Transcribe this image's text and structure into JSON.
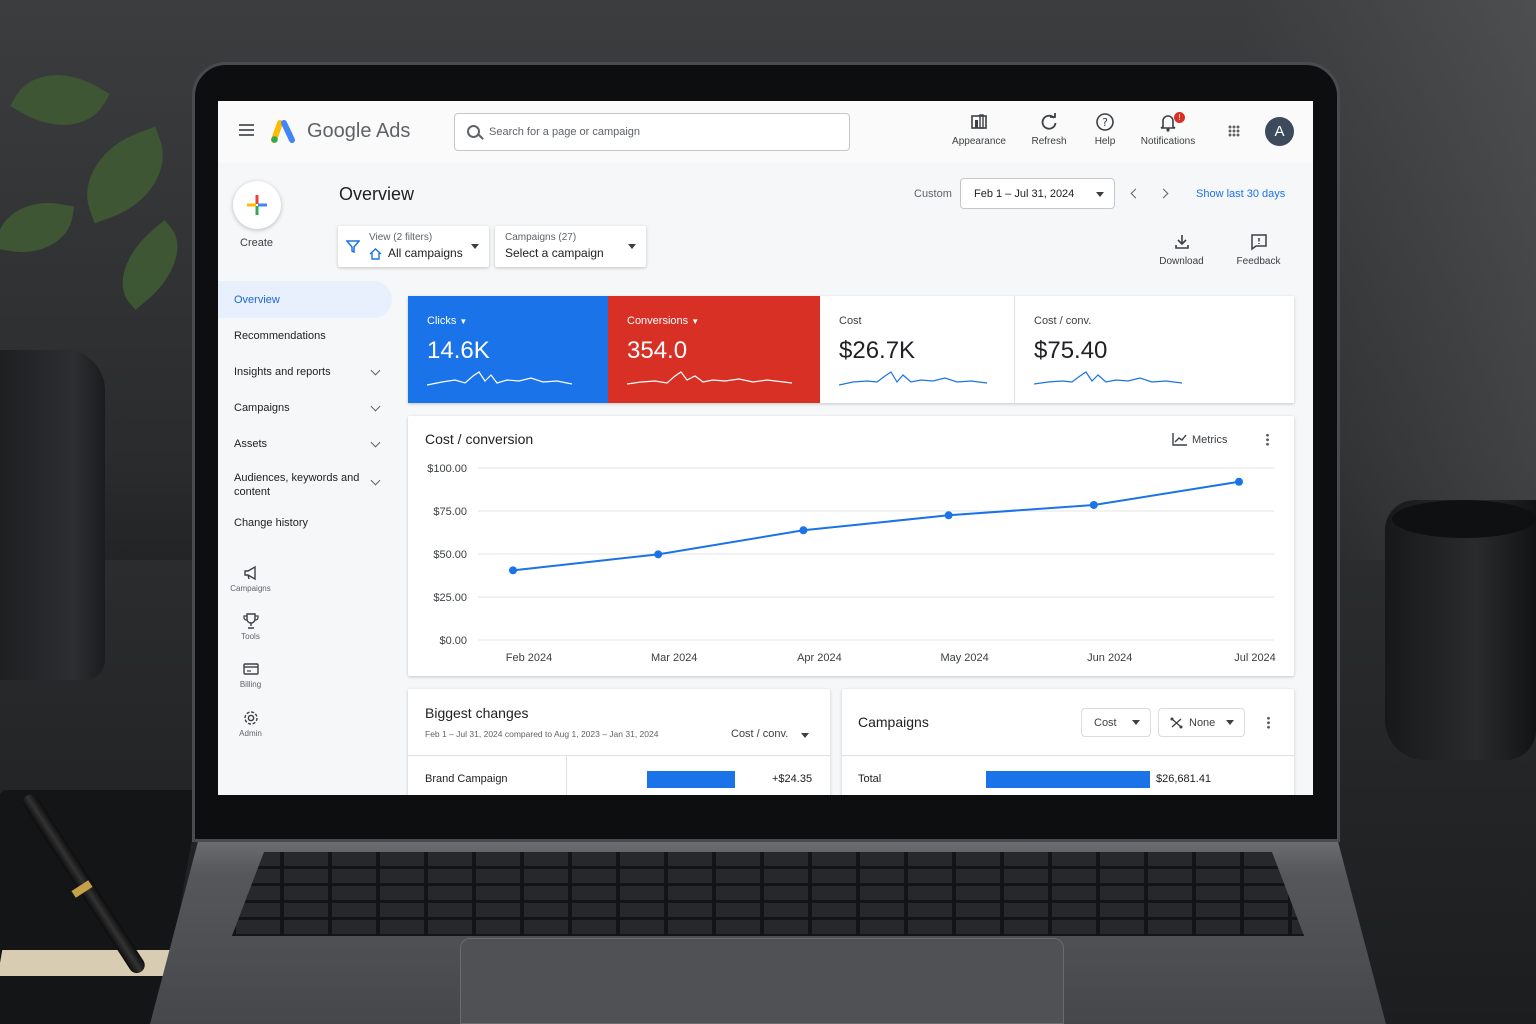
{
  "app": {
    "product_name": "Google Ads",
    "search_placeholder": "Search for a page or campaign",
    "avatar_letter": "A",
    "notification_count": "!",
    "toolbar": [
      {
        "label": "Appearance",
        "icon": "appearance-icon"
      },
      {
        "label": "Refresh",
        "icon": "refresh-icon"
      },
      {
        "label": "Help",
        "icon": "help-icon"
      },
      {
        "label": "Notifications",
        "icon": "bell-icon"
      }
    ]
  },
  "sidebar": {
    "create_label": "Create",
    "items": [
      {
        "label": "Overview",
        "active": true
      },
      {
        "label": "Recommendations"
      },
      {
        "label": "Insights and reports",
        "expandable": true
      },
      {
        "label": "Campaigns",
        "expandable": true
      },
      {
        "label": "Assets",
        "expandable": true
      },
      {
        "label": "Audiences, keywords and content",
        "expandable": true
      },
      {
        "label": "Change history"
      }
    ],
    "tools": [
      {
        "label": "Campaigns",
        "icon": "megaphone-icon"
      },
      {
        "label": "Tools",
        "icon": "trophy-icon"
      },
      {
        "label": "Billing",
        "icon": "billing-icon"
      },
      {
        "label": "Admin",
        "icon": "gear-icon"
      }
    ]
  },
  "header": {
    "title": "Overview",
    "date_mode": "Custom",
    "date_range": "Feb 1 – Jul 31, 2024",
    "show_last": "Show last 30 days",
    "view_filter_small": "View (2 filters)",
    "view_filter_value": "All campaigns",
    "campaign_filter_small": "Campaigns (27)",
    "campaign_filter_value": "Select a campaign",
    "download_label": "Download",
    "feedback_label": "Feedback"
  },
  "kpis": [
    {
      "label": "Clicks",
      "value": "14.6K",
      "color": "#1a73e8",
      "selected": true
    },
    {
      "label": "Conversions",
      "value": "354.0",
      "color": "#d93025",
      "selected": true
    },
    {
      "label": "Cost",
      "value": "$26.7K",
      "selected": false
    },
    {
      "label": "Cost / conv.",
      "value": "$75.40",
      "selected": false
    }
  ],
  "chart_card": {
    "title": "Cost / conversion",
    "metrics_label": "Metrics"
  },
  "chart_data": {
    "type": "line",
    "title": "Cost / conversion",
    "categories": [
      "Feb 2024",
      "Mar 2024",
      "Apr 2024",
      "May 2024",
      "Jun 2024",
      "Jul 2024"
    ],
    "series": [
      {
        "values": [
          40.5,
          49.8,
          63.8,
          72.5,
          78.5,
          92.0
        ],
        "color": "#1a73e8"
      }
    ],
    "yticks": [
      "$100.00",
      "$75.00",
      "$50.00",
      "$25.00",
      "$0.00"
    ],
    "ylim": [
      0,
      100
    ],
    "grid": true
  },
  "biggest_changes": {
    "title": "Biggest changes",
    "subtitle": "Feb 1 – Jul 31, 2024 compared to Aug 1, 2023 – Jan 31, 2024",
    "metric": "Cost / conv.",
    "rows": [
      {
        "name": "Brand Campaign",
        "change": "+$24.35",
        "bar_fraction": 1.0
      }
    ]
  },
  "campaigns_card": {
    "title": "Campaigns",
    "metric_select": "Cost",
    "segment_select": "None",
    "rows": [
      {
        "name": "Total",
        "value": "$26,681.41",
        "bar_fraction": 1.0
      }
    ]
  }
}
